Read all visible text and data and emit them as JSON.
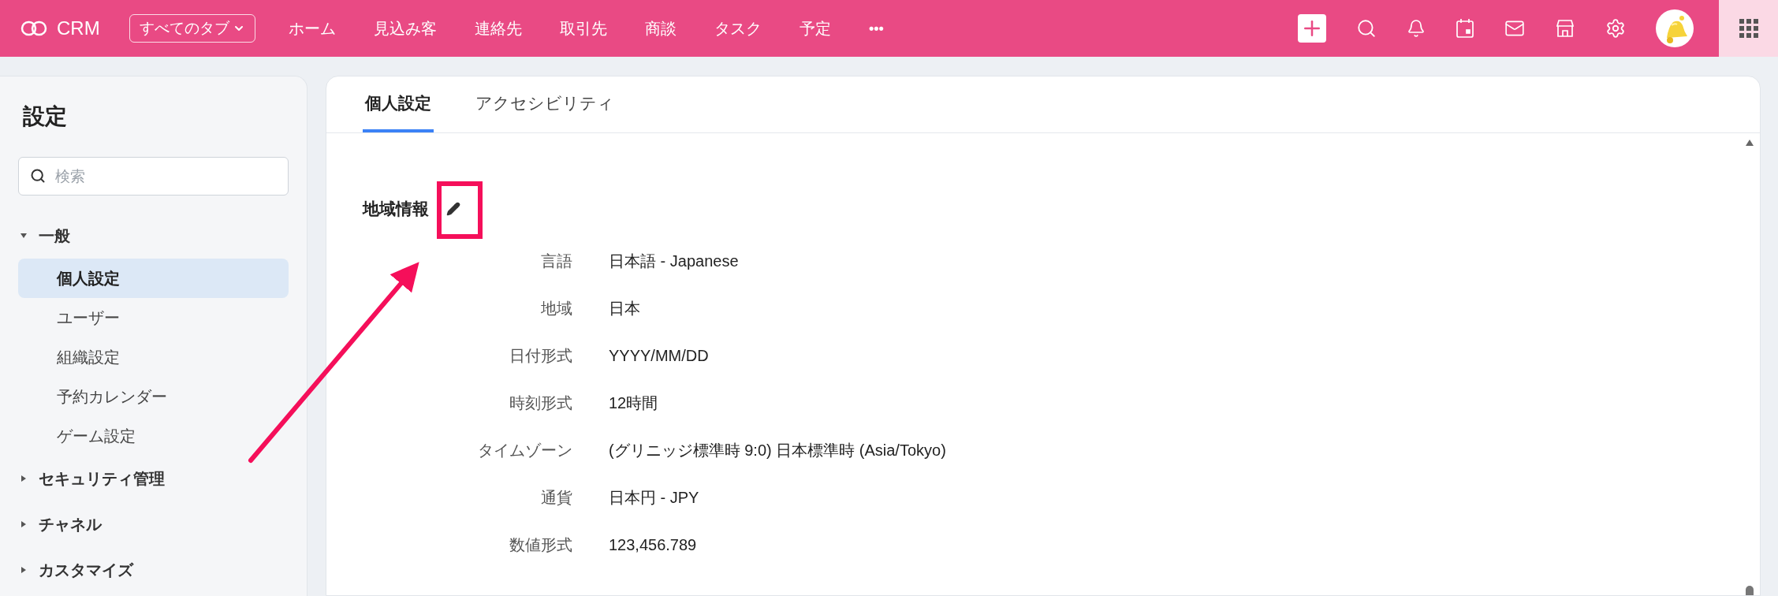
{
  "topbar": {
    "app_name": "CRM",
    "tab_menu": "すべてのタブ",
    "nav": [
      {
        "label": "ホーム"
      },
      {
        "label": "見込み客"
      },
      {
        "label": "連絡先"
      },
      {
        "label": "取引先"
      },
      {
        "label": "商談"
      },
      {
        "label": "タスク"
      },
      {
        "label": "予定"
      }
    ],
    "more": "•••"
  },
  "sidebar": {
    "title": "設定",
    "search": {
      "placeholder": "検索"
    },
    "groups": [
      {
        "label": "一般",
        "expanded": true,
        "children": [
          {
            "label": "個人設定",
            "selected": true
          },
          {
            "label": "ユーザー",
            "selected": false
          },
          {
            "label": "組織設定",
            "selected": false
          },
          {
            "label": "予約カレンダー",
            "selected": false
          },
          {
            "label": "ゲーム設定",
            "selected": false
          }
        ]
      },
      {
        "label": "セキュリティ管理",
        "expanded": false
      },
      {
        "label": "チャネル",
        "expanded": false
      },
      {
        "label": "カスタマイズ",
        "expanded": false
      }
    ]
  },
  "tabs": [
    {
      "label": "個人設定",
      "selected": true
    },
    {
      "label": "アクセシビリティ",
      "selected": false
    }
  ],
  "section": {
    "title": "地域情報",
    "fields": [
      {
        "label": "言語",
        "value": "日本語 - Japanese"
      },
      {
        "label": "地域",
        "value": "日本"
      },
      {
        "label": "日付形式",
        "value": "YYYY/MM/DD"
      },
      {
        "label": "時刻形式",
        "value": "12時間"
      },
      {
        "label": "タイムゾーン",
        "value": "(グリニッジ標準時 9:0) 日本標準時 (Asia/Tokyo)"
      },
      {
        "label": "通貨",
        "value": "日本円 - JPY"
      },
      {
        "label": "数値形式",
        "value": "123,456.789"
      }
    ]
  }
}
